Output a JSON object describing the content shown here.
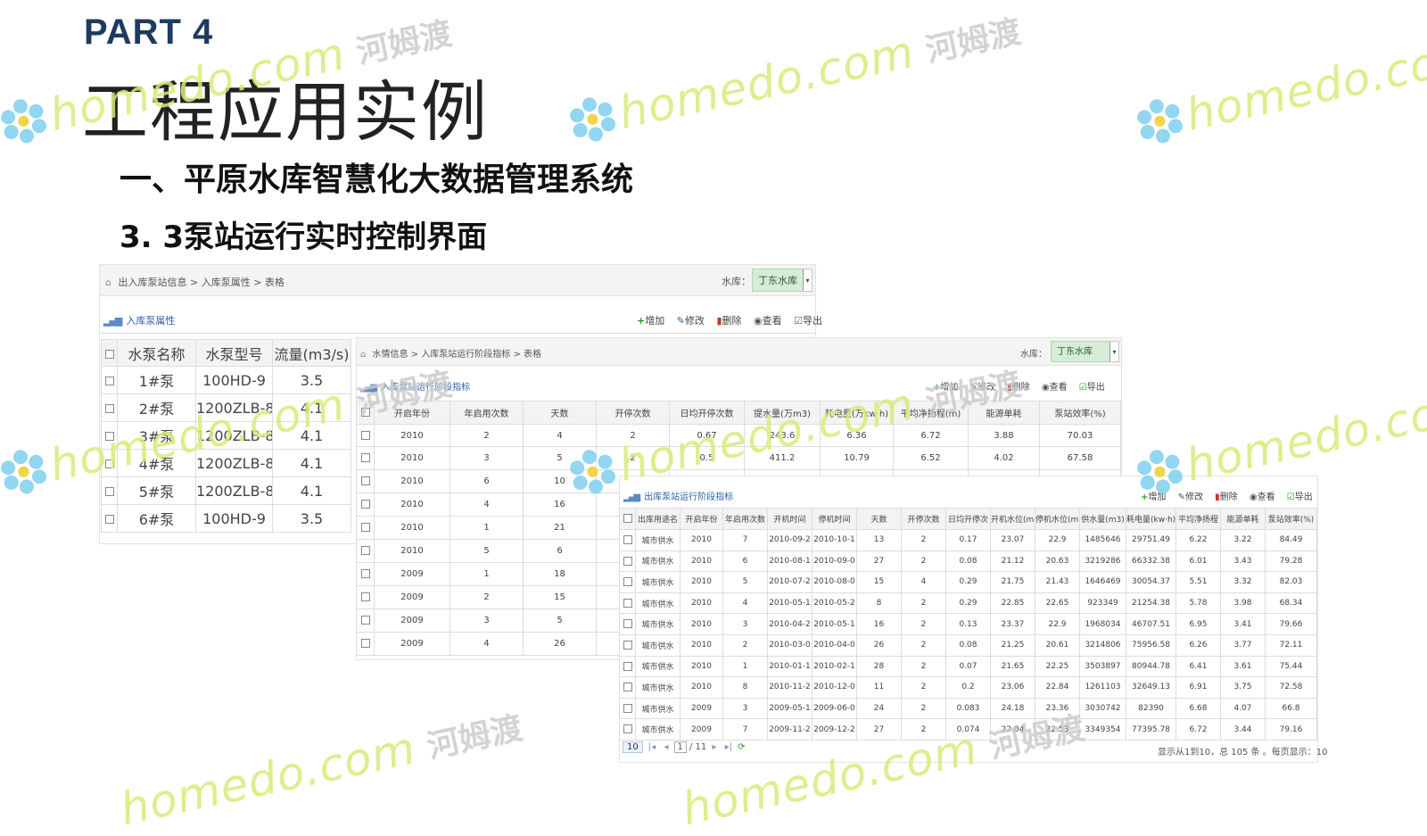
{
  "slide": {
    "part": "PART 4",
    "title": "工程应用实例",
    "subtitle1": "一、平原水库智慧化大数据管理系统",
    "subtitle2": "3. 3泵站运行实时控制界面"
  },
  "toolbar": {
    "add": "增加",
    "edit": "修改",
    "delete": "删除",
    "view": "查看",
    "export": "导出",
    "add_short": "增加"
  },
  "panel1": {
    "breadcrumb": [
      "出入库泵站信息",
      "入库泵属性",
      "表格"
    ],
    "reservoir_label": "水库：",
    "reservoir_value": "丁东水库",
    "title": "入库泵属性",
    "headers": [
      "水泵名称",
      "水泵型号",
      "流量(m3/s)"
    ],
    "rows": [
      [
        "1#泵",
        "100HD-9",
        "3.5"
      ],
      [
        "2#泵",
        "1200ZLB-85",
        "4.1"
      ],
      [
        "3#泵",
        "1200ZLB-85",
        "4.1"
      ],
      [
        "4#泵",
        "1200ZLB-85",
        "4.1"
      ],
      [
        "5#泵",
        "1200ZLB-85",
        "4.1"
      ],
      [
        "6#泵",
        "100HD-9",
        "3.5"
      ]
    ]
  },
  "panel2": {
    "breadcrumb": [
      "水情信息",
      "入库泵站运行阶段指标",
      "表格"
    ],
    "reservoir_label": "水库：",
    "reservoir_value": "丁东水库",
    "title": "入库泵站运行阶段指标",
    "headers": [
      "开启年份",
      "年启用次数",
      "天数",
      "开停次数",
      "日均开停次数",
      "提水量(万m3)",
      "耗电量(万kw·h)",
      "平均净扬程(m)",
      "能源单耗",
      "泵站效率(%)"
    ],
    "rows": [
      [
        "2010",
        "2",
        "4",
        "2",
        "0.67",
        "243.6",
        "6.36",
        "6.72",
        "3.88",
        "70.03"
      ],
      [
        "2010",
        "3",
        "5",
        "2",
        "0.5",
        "411.2",
        "10.79",
        "6.52",
        "4.02",
        "67.58"
      ],
      [
        "2010",
        "6",
        "10",
        "",
        "",
        "",
        "",
        "",
        "",
        ""
      ],
      [
        "2010",
        "4",
        "16",
        "",
        "",
        "",
        "",
        "",
        "",
        ""
      ],
      [
        "2010",
        "1",
        "21",
        "",
        "",
        "",
        "",
        "",
        "",
        ""
      ],
      [
        "2010",
        "5",
        "6",
        "",
        "",
        "",
        "",
        "",
        "",
        ""
      ],
      [
        "2009",
        "1",
        "18",
        "",
        "",
        "",
        "",
        "",
        "",
        ""
      ],
      [
        "2009",
        "2",
        "15",
        "",
        "",
        "",
        "",
        "",
        "",
        ""
      ],
      [
        "2009",
        "3",
        "5",
        "",
        "",
        "",
        "",
        "",
        "",
        ""
      ],
      [
        "2009",
        "4",
        "26",
        "",
        "",
        "",
        "",
        "",
        "",
        ""
      ]
    ]
  },
  "panel3": {
    "title": "出库泵站运行阶段指标",
    "headers": [
      "出库用途名",
      "开启年份",
      "年启用次数",
      "开机时间",
      "停机时间",
      "天数",
      "开停次数",
      "日均开停次",
      "开机水位(m)",
      "停机水位(m)",
      "供水量(m3)",
      "耗电量(kw·h)",
      "平均净扬程",
      "能源单耗",
      "泵站效率(%)"
    ],
    "rows": [
      [
        "城市供水",
        "2010",
        "7",
        "2010-09-2",
        "2010-10-1",
        "13",
        "2",
        "0.17",
        "23.07",
        "22.9",
        "1485646",
        "29751.49",
        "6.22",
        "3.22",
        "84.49"
      ],
      [
        "城市供水",
        "2010",
        "6",
        "2010-08-1",
        "2010-09-0",
        "27",
        "2",
        "0.08",
        "21.12",
        "20.63",
        "3219286",
        "66332.38",
        "6.01",
        "3.43",
        "79.28"
      ],
      [
        "城市供水",
        "2010",
        "5",
        "2010-07-2",
        "2010-08-0",
        "15",
        "4",
        "0.29",
        "21.75",
        "21.43",
        "1646469",
        "30054.37",
        "5.51",
        "3.32",
        "82.03"
      ],
      [
        "城市供水",
        "2010",
        "4",
        "2010-05-1",
        "2010-05-2",
        "8",
        "2",
        "0.29",
        "22.85",
        "22.65",
        "923349",
        "21254.38",
        "5.78",
        "3.98",
        "68.34"
      ],
      [
        "城市供水",
        "2010",
        "3",
        "2010-04-2",
        "2010-05-1",
        "16",
        "2",
        "0.13",
        "23.37",
        "22.9",
        "1968034",
        "46707.51",
        "6.95",
        "3.41",
        "79.66"
      ],
      [
        "城市供水",
        "2010",
        "2",
        "2010-03-0",
        "2010-04-0",
        "26",
        "2",
        "0.08",
        "21.25",
        "20.61",
        "3214806",
        "75956.58",
        "6.26",
        "3.77",
        "72.11"
      ],
      [
        "城市供水",
        "2010",
        "1",
        "2010-01-1",
        "2010-02-1",
        "28",
        "2",
        "0.07",
        "21.65",
        "22.25",
        "3503897",
        "80944.78",
        "6.41",
        "3.61",
        "75.44"
      ],
      [
        "城市供水",
        "2010",
        "8",
        "2010-11-2",
        "2010-12-0",
        "11",
        "2",
        "0.2",
        "23.06",
        "22.84",
        "1261103",
        "32649.13",
        "6.91",
        "3.75",
        "72.58"
      ],
      [
        "城市供水",
        "2009",
        "3",
        "2009-05-1",
        "2009-06-0",
        "24",
        "2",
        "0.083",
        "24.18",
        "23.36",
        "3030742",
        "82390",
        "6.68",
        "4.07",
        "66.8"
      ],
      [
        "城市供水",
        "2009",
        "7",
        "2009-11-2",
        "2009-12-2",
        "27",
        "2",
        "0.074",
        "22.04",
        "22.53",
        "3349354",
        "77395.78",
        "6.72",
        "3.44",
        "79.16"
      ]
    ],
    "pager": {
      "page_size": "10",
      "page_input": "1",
      "page_total": "/ 11",
      "info": "显示从1到10，总 105 条 。每页显示：10"
    }
  },
  "watermark": {
    "text": "homedo.com",
    "cn": "河姆渡"
  }
}
